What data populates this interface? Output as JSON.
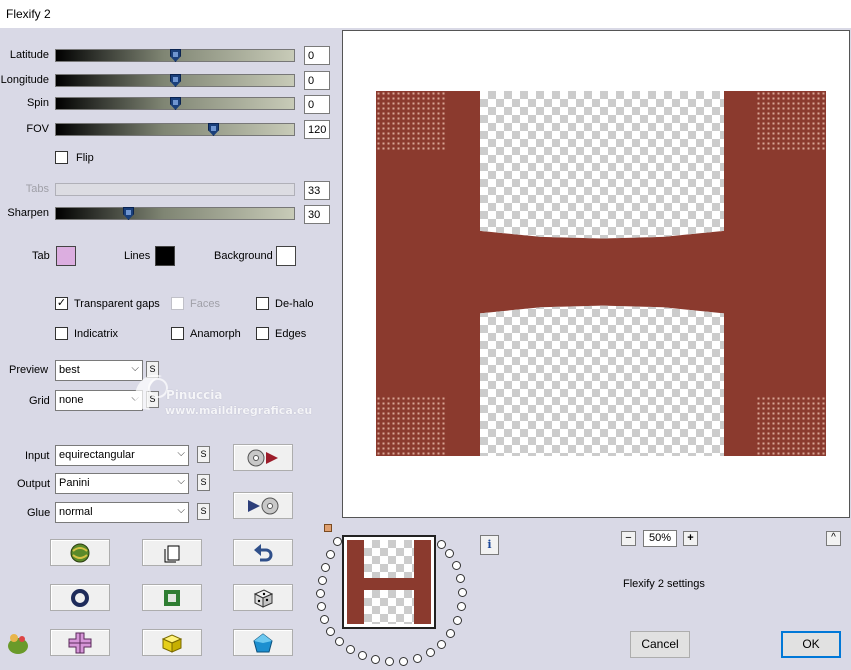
{
  "window": {
    "title": "Flexify 2"
  },
  "sliders": [
    {
      "label": "Latitude",
      "value": "0",
      "position": 0.5,
      "disabled": false
    },
    {
      "label": "Longitude",
      "value": "0",
      "position": 0.5,
      "disabled": false
    },
    {
      "label": "Spin",
      "value": "0",
      "position": 0.5,
      "disabled": false
    },
    {
      "label": "FOV",
      "value": "120",
      "position": 0.667,
      "disabled": false
    },
    {
      "label": "Tabs",
      "value": "33",
      "position": 0.33,
      "disabled": true
    },
    {
      "label": "Sharpen",
      "value": "30",
      "position": 0.3,
      "disabled": false
    }
  ],
  "flip": {
    "label": "Flip",
    "checked": false
  },
  "colors": {
    "tab_label": "Tab",
    "tab_color": "#dcaee0",
    "lines_label": "Lines",
    "lines_color": "#000000",
    "background_label": "Background",
    "background_color": "#ffffff"
  },
  "options": {
    "transparent_gaps": {
      "label": "Transparent gaps",
      "checked": true
    },
    "faces": {
      "label": "Faces",
      "checked": false,
      "disabled": true
    },
    "de_halo": {
      "label": "De-halo",
      "checked": false
    },
    "indicatrix": {
      "label": "Indicatrix",
      "checked": false
    },
    "anamorph": {
      "label": "Anamorph",
      "checked": false
    },
    "edges": {
      "label": "Edges",
      "checked": false
    }
  },
  "preview_select": {
    "label": "Preview",
    "value": "best",
    "s": "S"
  },
  "grid_select": {
    "label": "Grid",
    "value": "none",
    "s": "S"
  },
  "input_select": {
    "label": "Input",
    "value": "equirectangular",
    "s": "S"
  },
  "output_select": {
    "label": "Output",
    "value": "Panini",
    "s": "S"
  },
  "glue_select": {
    "label": "Glue",
    "value": "normal",
    "s": "S"
  },
  "watermark": {
    "line1": "Pinuccia",
    "line2": "www.maildiregrafica.eu"
  },
  "zoom": {
    "value": "50%",
    "minus": "−",
    "plus": "+"
  },
  "info_icon": "i",
  "collapse_icon": "^",
  "settings_text": "Flexify 2 settings",
  "buttons": {
    "cancel": "Cancel",
    "ok": "OK"
  },
  "accent": "#0078d7",
  "preview_color": "#8b3a2e"
}
